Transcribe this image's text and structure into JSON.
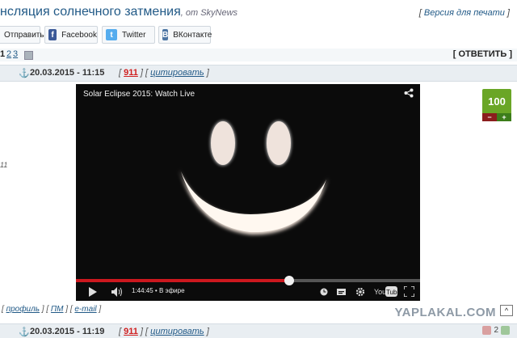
{
  "header": {
    "title": "нсляция солнечного затмения",
    "by": ", от SkyNews",
    "print_open": "[ ",
    "print_link": "Версия для печати",
    "print_close": " ]"
  },
  "share": {
    "send": "Отправить",
    "facebook": "Facebook",
    "twitter": "Twitter",
    "vk": "ВКонтакте"
  },
  "pager": {
    "pages": [
      "1",
      "2",
      "3"
    ],
    "reply": "[ ОТВЕТИТЬ ]"
  },
  "post": {
    "date": "20.03.2015 - 11:15",
    "open": "[ ",
    "number": "911",
    "mid": " ] [ ",
    "quote": "цитировать",
    "close": " ]",
    "left_mark": "11"
  },
  "video": {
    "title": "Solar Eclipse 2015: Watch Live",
    "time": "1:44:45 • В эфире",
    "progress": 0.62
  },
  "rating": {
    "value": "100",
    "minus": "−",
    "plus": "+",
    "colors": {
      "green": "#6aa626",
      "minus": "#8b1d1d",
      "plus": "#3c7d1a"
    }
  },
  "profile": {
    "p1": "[ ",
    "profile": "профиль",
    "p2": " ] [ ",
    "pm": "ПМ",
    "p3": " ] [ ",
    "email": "e-mail",
    "p4": " ]"
  },
  "brand": "YAPLAKAL.COM",
  "uparrow": "^",
  "post2": {
    "date": "20.03.2015 - 11:19",
    "open": "[ ",
    "number": "911",
    "mid": " ] [ ",
    "quote": "цитировать",
    "close": " ]",
    "votes": "2"
  }
}
